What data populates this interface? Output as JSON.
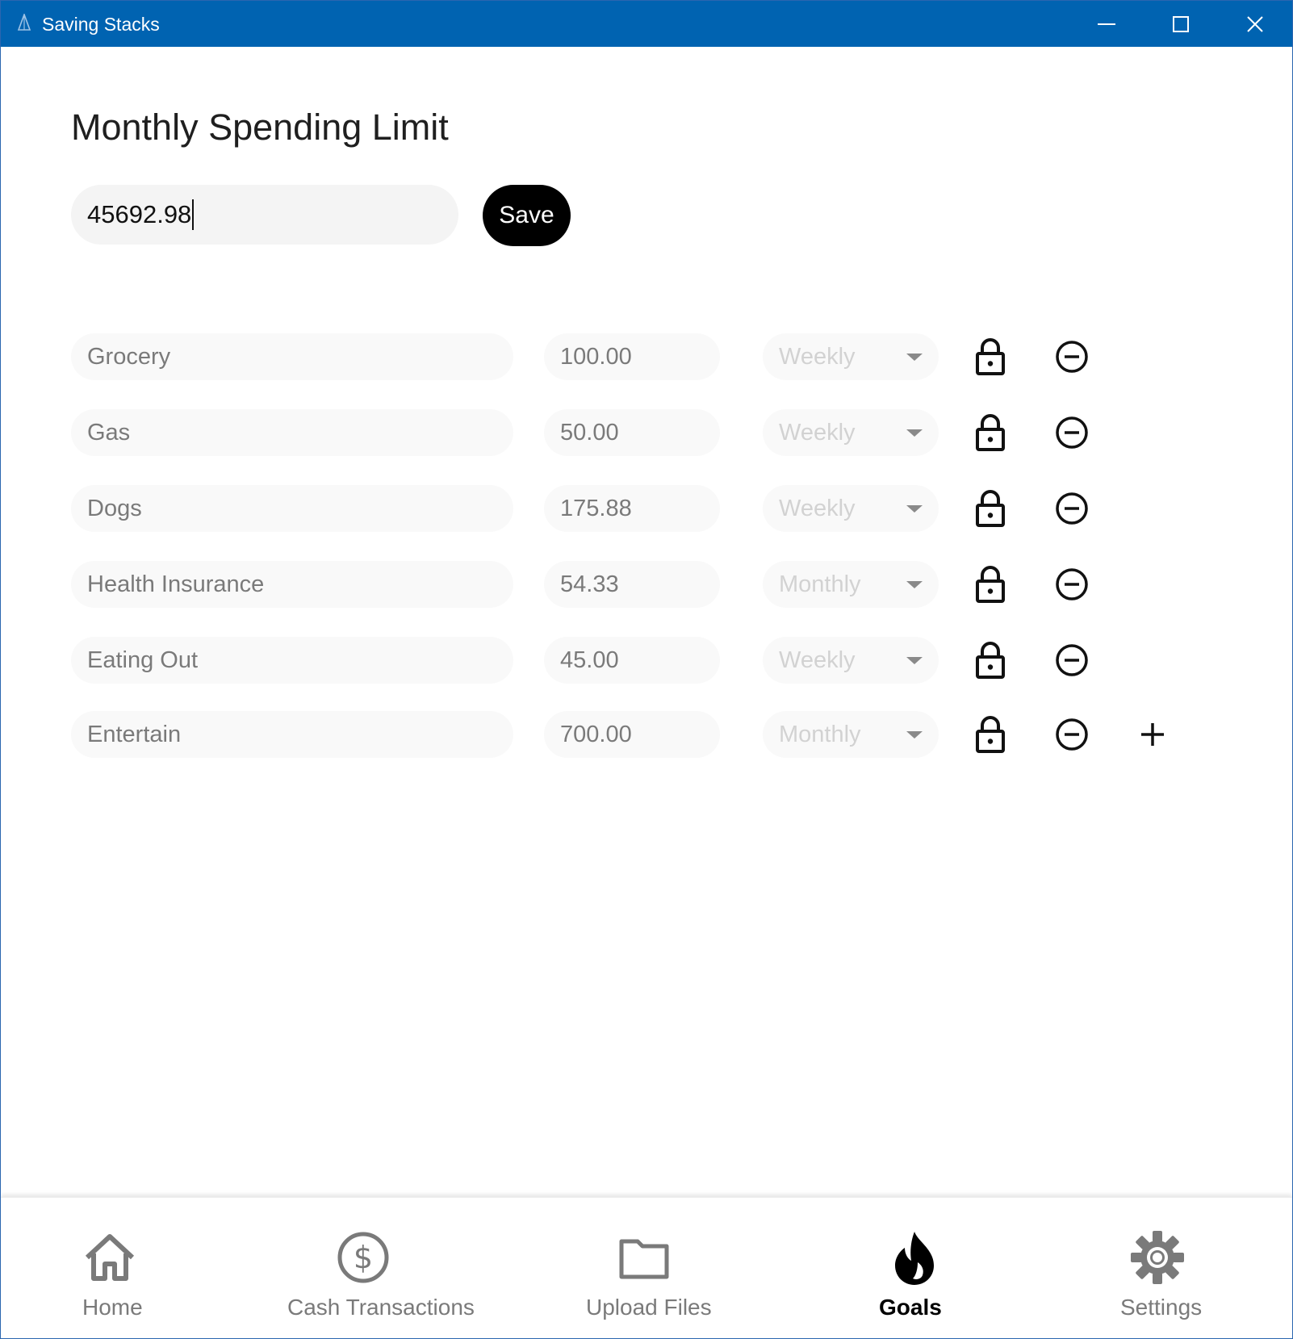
{
  "window": {
    "title": "Saving Stacks",
    "titlebar_color": "#0063b1"
  },
  "limit": {
    "heading": "Monthly Spending Limit",
    "value": "45692.98",
    "save_label": "Save"
  },
  "budget_items": [
    {
      "name": "Grocery",
      "amount": "100.00",
      "period": "Weekly"
    },
    {
      "name": "Gas",
      "amount": "50.00",
      "period": "Weekly"
    },
    {
      "name": "Dogs",
      "amount": "175.88",
      "period": "Weekly"
    },
    {
      "name": "Health Insurance",
      "amount": "54.33",
      "period": "Monthly"
    },
    {
      "name": "Eating Out",
      "amount": "45.00",
      "period": "Weekly"
    },
    {
      "name": "Entertain",
      "amount": "700.00",
      "period": "Monthly"
    }
  ],
  "nav": {
    "items": [
      {
        "label": "Home",
        "icon": "home-icon",
        "active": false
      },
      {
        "label": "Cash Transactions",
        "icon": "dollar-icon",
        "active": false
      },
      {
        "label": "Upload Files",
        "icon": "folder-icon",
        "active": false
      },
      {
        "label": "Goals",
        "icon": "flame-icon",
        "active": true
      },
      {
        "label": "Settings",
        "icon": "gear-icon",
        "active": false
      }
    ],
    "active_color": "#000000",
    "inactive_color": "#7a7a7a"
  }
}
